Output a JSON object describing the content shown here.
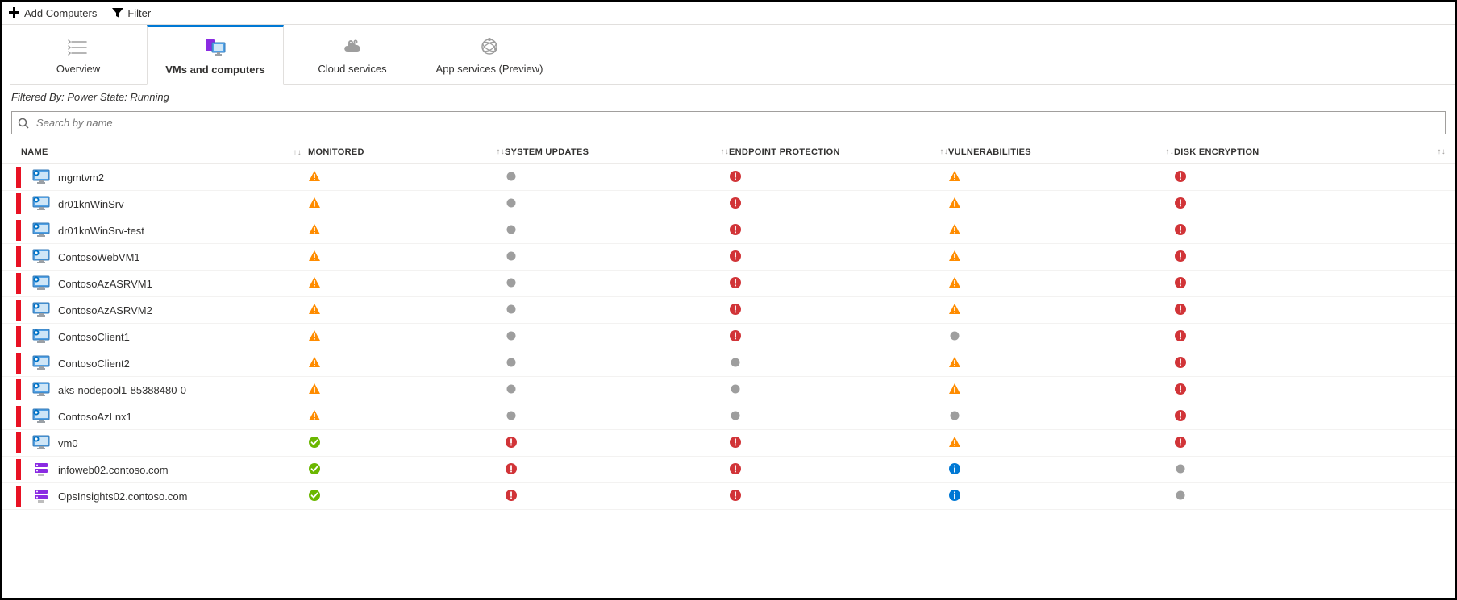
{
  "toolbar": {
    "add_label": "Add Computers",
    "filter_label": "Filter"
  },
  "tabs": [
    {
      "id": "overview",
      "label": "Overview"
    },
    {
      "id": "vms",
      "label": "VMs and computers"
    },
    {
      "id": "cloud",
      "label": "Cloud services"
    },
    {
      "id": "appsvc",
      "label": "App services (Preview)"
    }
  ],
  "active_tab": "vms",
  "filter_text": "Filtered By: Power State: Running",
  "search": {
    "placeholder": "Search by name"
  },
  "columns": {
    "name": "NAME",
    "monitored": "MONITORED",
    "system_updates": "SYSTEM UPDATES",
    "endpoint_protection": "ENDPOINT PROTECTION",
    "vulnerabilities": "VULNERABILITIES",
    "disk_encryption": "DISK ENCRYPTION"
  },
  "icons": {
    "vm": "vm",
    "server": "server"
  },
  "rows": [
    {
      "name": "mgmtvm2",
      "type": "vm",
      "monitored": "warn",
      "sys": "none",
      "ep": "error",
      "vul": "warn",
      "de": "error"
    },
    {
      "name": "dr01knWinSrv",
      "type": "vm",
      "monitored": "warn",
      "sys": "none",
      "ep": "error",
      "vul": "warn",
      "de": "error"
    },
    {
      "name": "dr01knWinSrv-test",
      "type": "vm",
      "monitored": "warn",
      "sys": "none",
      "ep": "error",
      "vul": "warn",
      "de": "error"
    },
    {
      "name": "ContosoWebVM1",
      "type": "vm",
      "monitored": "warn",
      "sys": "none",
      "ep": "error",
      "vul": "warn",
      "de": "error"
    },
    {
      "name": "ContosoAzASRVM1",
      "type": "vm",
      "monitored": "warn",
      "sys": "none",
      "ep": "error",
      "vul": "warn",
      "de": "error"
    },
    {
      "name": "ContosoAzASRVM2",
      "type": "vm",
      "monitored": "warn",
      "sys": "none",
      "ep": "error",
      "vul": "warn",
      "de": "error"
    },
    {
      "name": "ContosoClient1",
      "type": "vm",
      "monitored": "warn",
      "sys": "none",
      "ep": "error",
      "vul": "none",
      "de": "error"
    },
    {
      "name": "ContosoClient2",
      "type": "vm",
      "monitored": "warn",
      "sys": "none",
      "ep": "none",
      "vul": "warn",
      "de": "error"
    },
    {
      "name": "aks-nodepool1-85388480-0",
      "type": "vm",
      "monitored": "warn",
      "sys": "none",
      "ep": "none",
      "vul": "warn",
      "de": "error"
    },
    {
      "name": "ContosoAzLnx1",
      "type": "vm",
      "monitored": "warn",
      "sys": "none",
      "ep": "none",
      "vul": "none",
      "de": "error"
    },
    {
      "name": "vm0",
      "type": "vm",
      "monitored": "ok",
      "sys": "error",
      "ep": "error",
      "vul": "warn",
      "de": "error"
    },
    {
      "name": "infoweb02.contoso.com",
      "type": "server",
      "monitored": "ok",
      "sys": "error",
      "ep": "error",
      "vul": "info",
      "de": "none"
    },
    {
      "name": "OpsInsights02.contoso.com",
      "type": "server",
      "monitored": "ok",
      "sys": "error",
      "ep": "error",
      "vul": "info",
      "de": "none"
    }
  ]
}
